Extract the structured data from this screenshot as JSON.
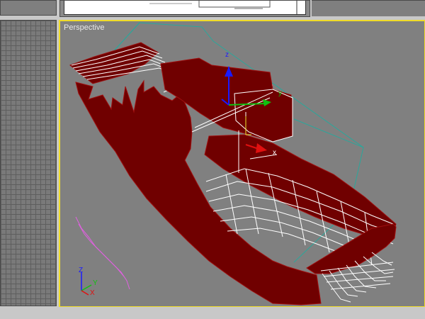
{
  "viewport": {
    "label": "Perspective"
  },
  "axis_tripod": {
    "x": "X",
    "y": "Y",
    "z": "Z"
  },
  "gizmo": {
    "x": "x",
    "y": "y",
    "z": "z"
  },
  "colors": {
    "active_border": "#f0dc28",
    "hull": "#700000",
    "wire": "#ffffff",
    "bbox": "#2aa79b",
    "gizmo_x": "#e01010",
    "gizmo_y": "#10c010",
    "gizmo_z": "#1a1aff",
    "spline": "#e060e0"
  }
}
